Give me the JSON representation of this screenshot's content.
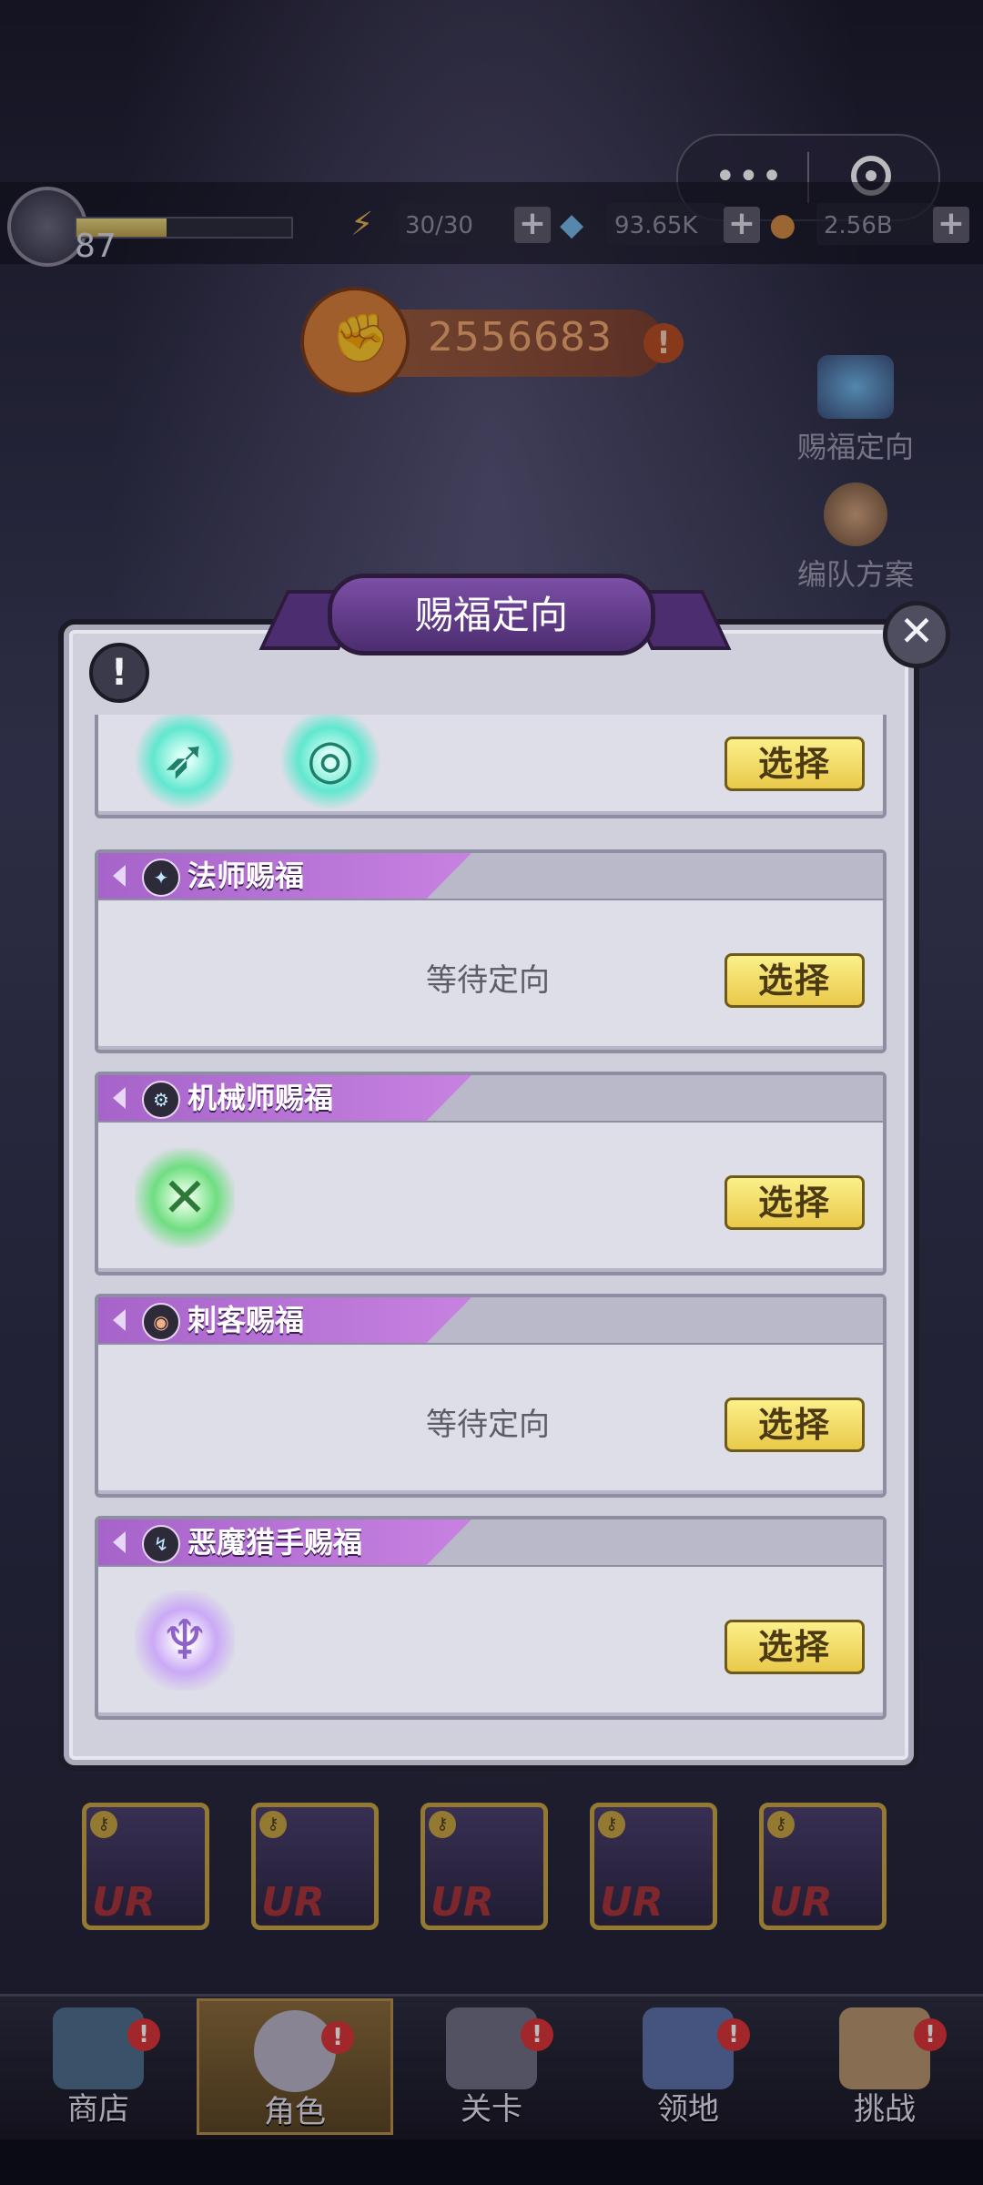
{
  "capsule": {
    "more_icon": "more-dots-icon",
    "close_icon": "target-icon"
  },
  "player": {
    "level": "87",
    "xp_progress": 0.42
  },
  "resources": [
    {
      "icon": "energy-icon",
      "value": "30/30"
    },
    {
      "icon": "gem-icon",
      "value": "93.65K"
    },
    {
      "icon": "coin-icon",
      "value": "2.56B"
    }
  ],
  "power": {
    "value": "2556683"
  },
  "side_buttons": {
    "blessing": "赐福定向",
    "formation": "编队方案"
  },
  "modal": {
    "title": "赐福定向",
    "cards": [
      {
        "id": "first",
        "label": "",
        "state": "icons",
        "button": "选择"
      },
      {
        "id": "mage",
        "label": "法师赐福",
        "state": "等待定向",
        "button": "选择"
      },
      {
        "id": "mechanic",
        "label": "机械师赐福",
        "state": "icon",
        "button": "选择"
      },
      {
        "id": "assassin",
        "label": "刺客赐福",
        "state": "等待定向",
        "button": "选择"
      },
      {
        "id": "hunter",
        "label": "恶魔猎手赐福",
        "state": "icon",
        "button": "选择"
      }
    ]
  },
  "heroes": {
    "rarity": "UR"
  },
  "nav": {
    "shop": "商店",
    "role": "角色",
    "stage": "关卡",
    "territory": "领地",
    "challenge": "挑战",
    "badge": "!"
  },
  "colors": {
    "accent_purple": "#b46fd6",
    "button_yellow": "#f2dc64",
    "modal_bg": "#cfd0dc"
  }
}
